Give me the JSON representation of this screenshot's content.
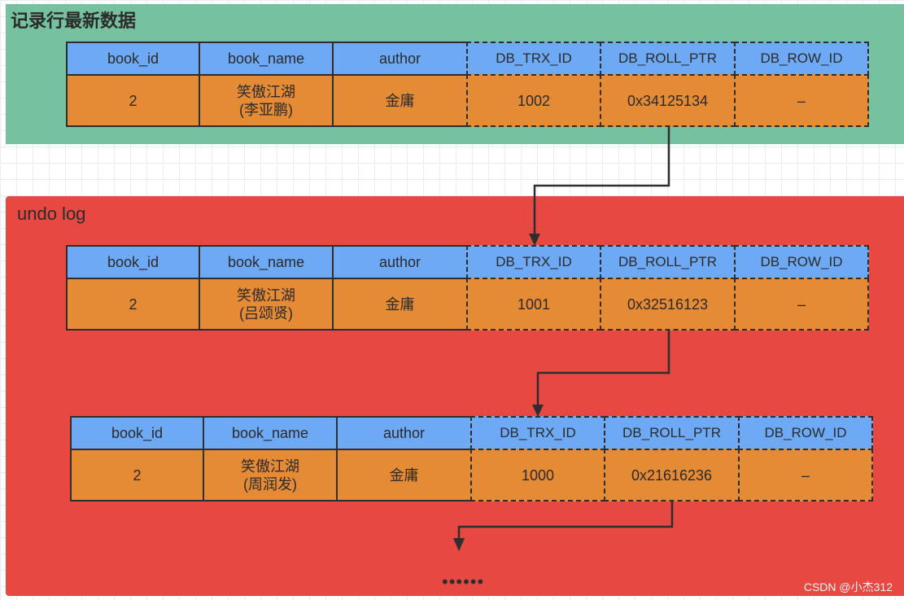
{
  "panels": {
    "current": {
      "title": "记录行最新数据",
      "color": "#76c1a0"
    },
    "undo": {
      "title": "undo log",
      "color": "#e84842"
    }
  },
  "columns": [
    "book_id",
    "book_name",
    "author",
    "DB_TRX_ID",
    "DB_ROLL_PTR",
    "DB_ROW_ID"
  ],
  "hidden_column_style": [
    "solid",
    "solid",
    "solid",
    "dashed",
    "dashed",
    "dashed"
  ],
  "colors": {
    "header": "#6ea9f5",
    "row": "#e58a35",
    "border": "#2e2e2e"
  },
  "records": [
    {
      "book_id": "2",
      "book_name_line1": "笑傲江湖",
      "book_name_line2": "(李亚鹏)",
      "author": "金庸",
      "DB_TRX_ID": "1002",
      "DB_ROLL_PTR": "0x34125134",
      "DB_ROW_ID": "–"
    },
    {
      "book_id": "2",
      "book_name_line1": "笑傲江湖",
      "book_name_line2": "(吕颂贤)",
      "author": "金庸",
      "DB_TRX_ID": "1001",
      "DB_ROLL_PTR": "0x32516123",
      "DB_ROW_ID": "–"
    },
    {
      "book_id": "2",
      "book_name_line1": "笑傲江湖",
      "book_name_line2": "(周润发)",
      "author": "金庸",
      "DB_TRX_ID": "1000",
      "DB_ROLL_PTR": "0x21616236",
      "DB_ROW_ID": "–"
    }
  ],
  "continuation": "••••••",
  "watermark": "CSDN @小杰312"
}
